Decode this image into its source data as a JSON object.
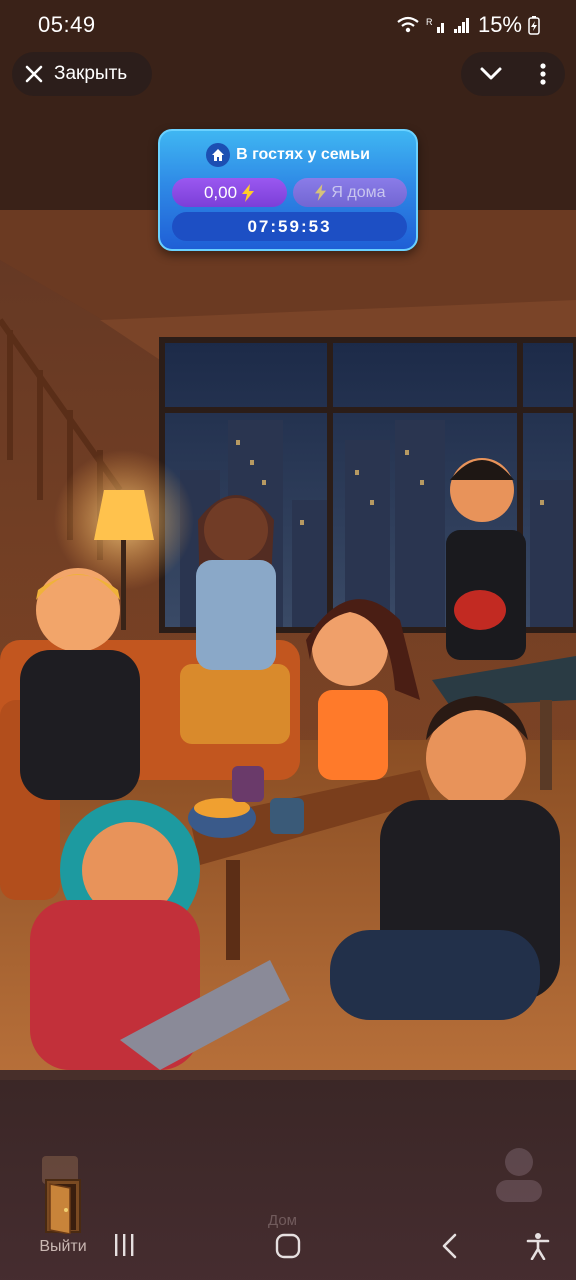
{
  "status_bar": {
    "time": "05:49",
    "battery_percent": "15%",
    "icons": [
      "wifi-icon",
      "signal-r-icon",
      "signal-icon",
      "battery-charging-icon"
    ]
  },
  "top_bar": {
    "close_label": "Закрыть",
    "close_icon": "close-icon",
    "collapse_icon": "chevron-down-icon",
    "more_icon": "more-vertical-icon"
  },
  "status_card": {
    "title": "В гостях у семьи",
    "title_icon": "home-icon",
    "balance": "0,00",
    "balance_icon": "lightning-icon",
    "home_button_label": "Я дома",
    "timer": "07:59:53"
  },
  "bottom": {
    "exit_label": "Выйти",
    "exit_icon": "door-icon",
    "home_tab_label": "Дом"
  },
  "colors": {
    "card_blue": "#2f8ae6",
    "balance_purple": "#7b3fd8",
    "lightning": "#ffcc2a"
  }
}
